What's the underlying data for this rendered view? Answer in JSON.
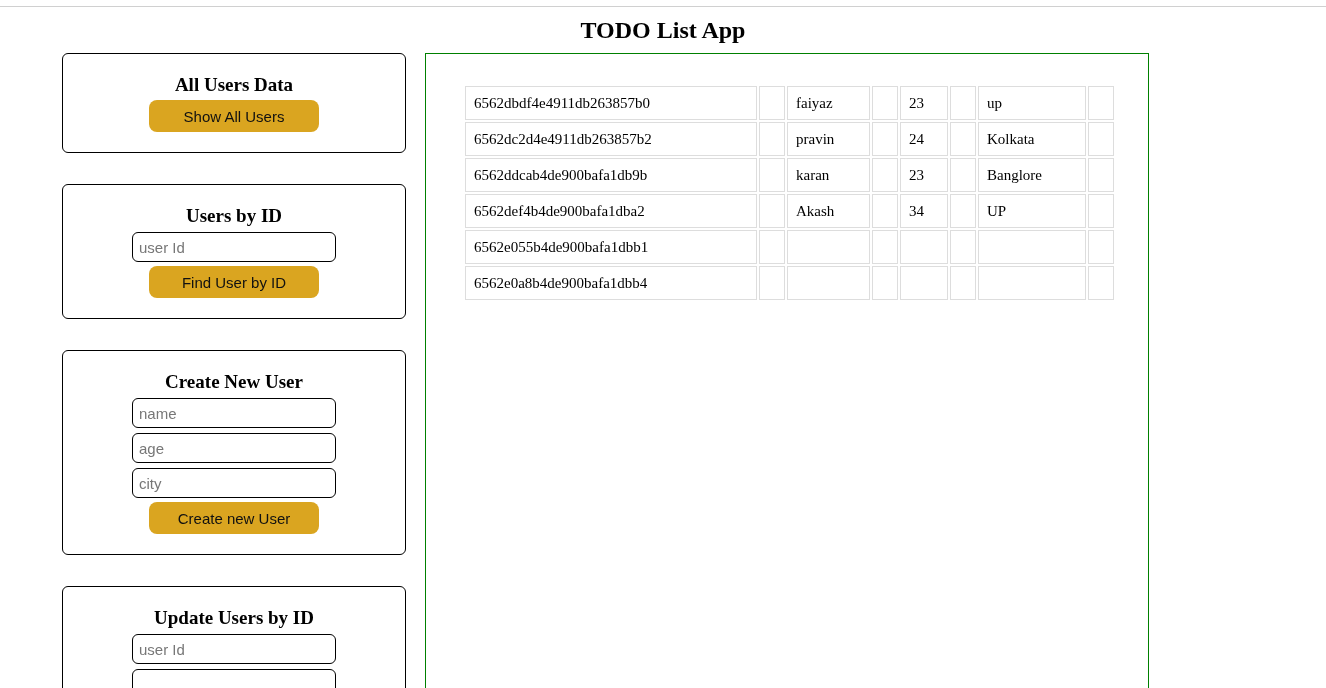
{
  "title": "TODO List App",
  "cards": [
    {
      "heading": "All Users Data",
      "button": "Show All Users"
    },
    {
      "heading": "Users by ID",
      "fields": [
        {
          "kind": "text",
          "placeholder": "user Id"
        }
      ],
      "button": "Find User by ID"
    },
    {
      "heading": "Create New User",
      "fields": [
        {
          "kind": "text",
          "placeholder": "name"
        },
        {
          "kind": "text",
          "placeholder": "age"
        },
        {
          "kind": "text",
          "placeholder": "city"
        }
      ],
      "button": "Create new User"
    },
    {
      "heading": "Update Users by ID",
      "fields": [
        {
          "kind": "text",
          "placeholder": "user Id"
        },
        {
          "kind": "text"
        }
      ]
    }
  ],
  "table": {
    "rows": [
      {
        "id": "6562dbdf4e4911db263857b0",
        "name": "faiyaz",
        "age": "23",
        "city": "up"
      },
      {
        "id": "6562dc2d4e4911db263857b2",
        "name": "pravin",
        "age": "24",
        "city": "Kolkata"
      },
      {
        "id": "6562ddcab4de900bafa1db9b",
        "name": "karan",
        "age": "23",
        "city": "Banglore"
      },
      {
        "id": "6562def4b4de900bafa1dba2",
        "name": "Akash",
        "age": "34",
        "city": "UP"
      },
      {
        "id": "6562e055b4de900bafa1dbb1"
      },
      {
        "id": "6562e0a8b4de900bafa1dbb4"
      }
    ]
  }
}
